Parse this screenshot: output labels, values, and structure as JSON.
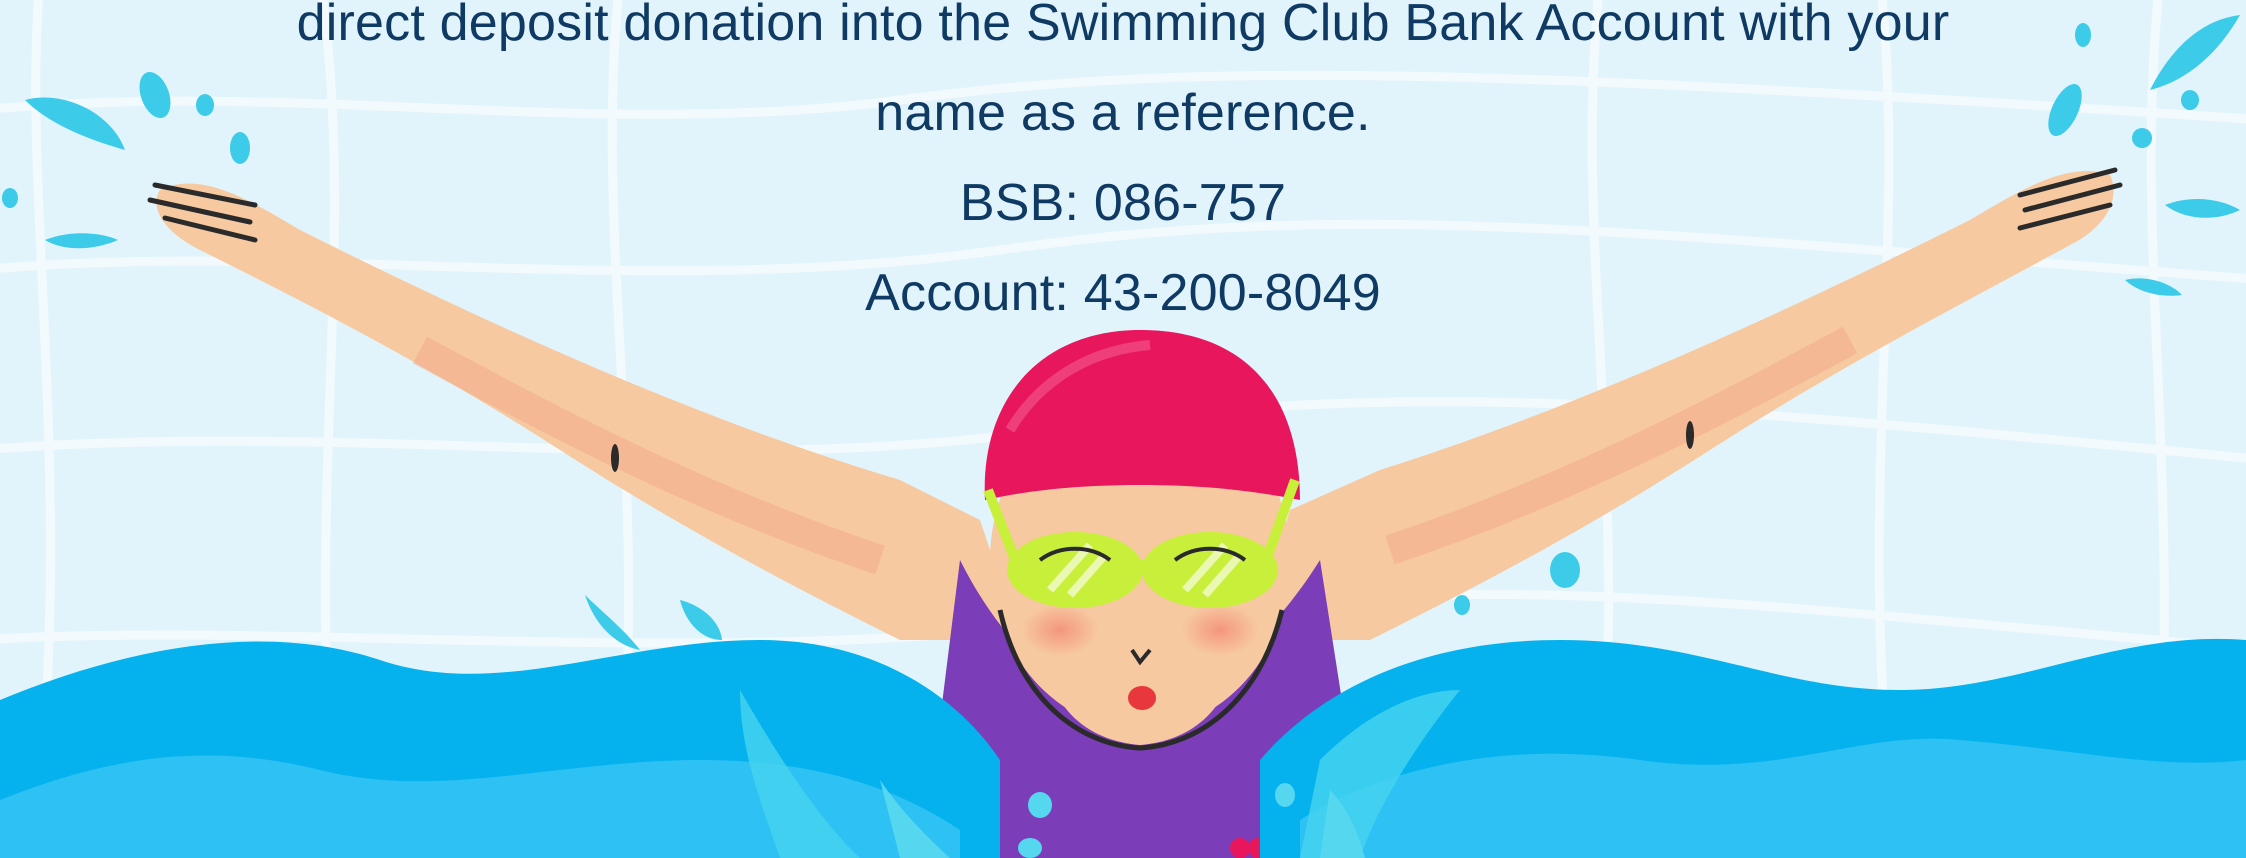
{
  "message": {
    "line1": "direct deposit donation into the Swimming Club Bank Account with your",
    "line2": "name as a reference.",
    "bsb": "BSB: 086-757",
    "account": "Account: 43-200-8049"
  },
  "colors": {
    "background": "#e2f4fb",
    "grid_lines": "#f5fbfe",
    "text": "#0f3a63",
    "water_dark": "#05b2ee",
    "water_light": "#2ec1f4",
    "swim_cap": "#e8175d",
    "goggles": "#c8ef3a",
    "swimsuit": "#7b3db8",
    "skin": "#f6c9a0",
    "splash": "#3ccbe8"
  },
  "illustration": {
    "subject": "swimmer-doing-butterfly-stroke",
    "icons": [
      "swim-cap-icon",
      "goggles-icon",
      "water-splash-icon"
    ]
  }
}
